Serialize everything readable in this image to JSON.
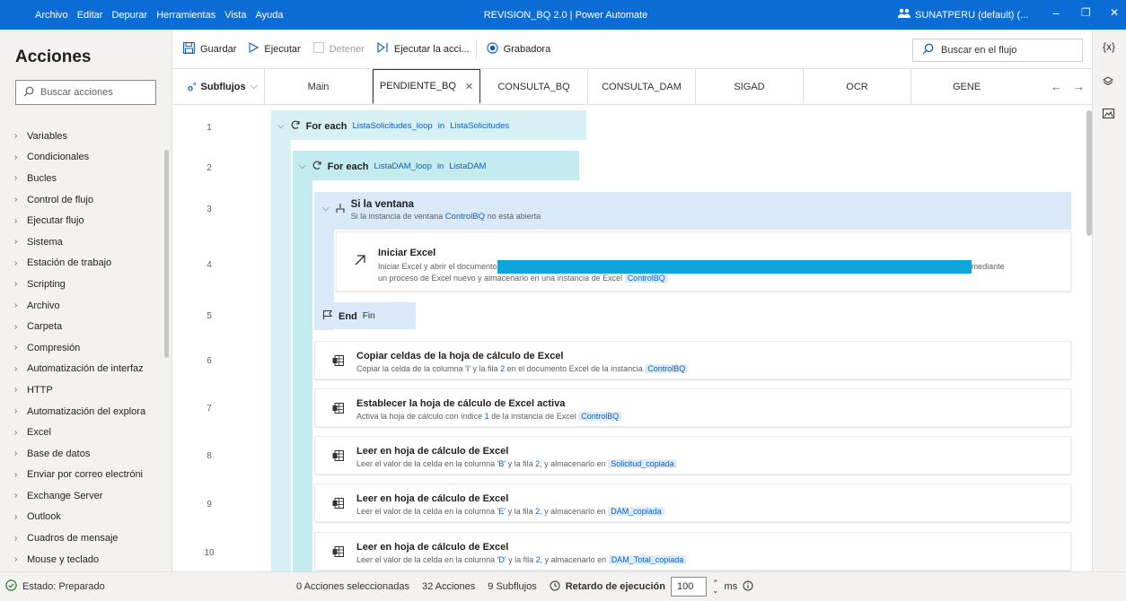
{
  "titlebar": {
    "menu": [
      "Archivo",
      "Editar",
      "Depurar",
      "Herramientas",
      "Vista",
      "Ayuda"
    ],
    "title": "REVISION_BQ 2.0 | Power Automate",
    "account": "SUNATPERU (default) (...",
    "minimize": "−",
    "maximize": "❐",
    "close": "✕"
  },
  "left": {
    "title": "Acciones",
    "search_placeholder": "Buscar acciones",
    "items": [
      "Variables",
      "Condicionales",
      "Bucles",
      "Control de flujo",
      "Ejecutar flujo",
      "Sistema",
      "Estación de trabajo",
      "Scripting",
      "Archivo",
      "Carpeta",
      "Compresión",
      "Automatización de interfaz",
      "HTTP",
      "Automatización del explora",
      "Excel",
      "Base de datos",
      "Enviar por correo electróni",
      "Exchange Server",
      "Outlook",
      "Cuadros de mensaje",
      "Mouse y teclado"
    ]
  },
  "toolbar": {
    "save": "Guardar",
    "run": "Ejecutar",
    "stop": "Detener",
    "run_action": "Ejecutar la acci...",
    "recorder": "Grabadora",
    "flow_search": "Buscar en el flujo"
  },
  "tabs": {
    "subflows": "Subflujos",
    "items": [
      "Main",
      "PENDIENTE_BQ",
      "CONSULTA_BQ",
      "CONSULTA_DAM",
      "SIGAD",
      "OCR",
      "GENE"
    ],
    "active_close": "✕"
  },
  "rightbar": {
    "vars_label": "{x}"
  },
  "flow": {
    "line_numbers": [
      "1",
      "2",
      "3",
      "4",
      "5",
      "6",
      "7",
      "8",
      "9",
      "10"
    ],
    "loop1": {
      "kw": "For each",
      "var": "ListaSolicitudes_loop",
      "in": "in",
      "list": "ListaSolicitudes"
    },
    "loop2": {
      "kw": "For each",
      "var": "ListaDAM_loop",
      "in": "in",
      "list": "ListaDAM"
    },
    "if": {
      "title": "Si la ventana",
      "desc_pre": "Si la instancia de ventana",
      "var": "ControlBQ",
      "desc_post": "no está abierta"
    },
    "excel_start": {
      "title": "Iniciar Excel",
      "desc1_pre": "Iniciar Excel y abrir el documento",
      "desc1_post": "mediante",
      "desc2_pre": "un proceso de Excel nuevo y almacenarlo en una instancia de Excel",
      "var": "ControlBQ"
    },
    "end": {
      "kw": "End",
      "label": "Fin"
    },
    "copy": {
      "title": "Copiar celdas de la hoja de cálculo de Excel",
      "desc_a": "Copiar la celda de la columna",
      "col": "'I'",
      "desc_b": "y la fila",
      "row": "2",
      "desc_c": "en el documento Excel de la instancia",
      "var": "ControlBQ"
    },
    "activate": {
      "title": "Establecer la hoja de cálculo de Excel activa",
      "desc_a": "Activa la hoja de cálculo con índice",
      "idx": "1",
      "desc_b": "de la instancia de Excel",
      "var": "ControlBQ"
    },
    "read1": {
      "title": "Leer en hoja de cálculo de Excel",
      "desc_a": "Leer el valor de la celda en la columna",
      "col": "'B'",
      "desc_b": "y la fila",
      "row": "2",
      "desc_c": ", y almacenarlo en",
      "var": "Solicitud_copiada"
    },
    "read2": {
      "title": "Leer en hoja de cálculo de Excel",
      "desc_a": "Leer el valor de la celda en la columna",
      "col": "'E'",
      "desc_b": "y la fila",
      "row": "2",
      "desc_c": ", y almacenarlo en",
      "var": "DAM_copiada"
    },
    "read3": {
      "title": "Leer en hoja de cálculo de Excel",
      "desc_a": "Leer el valor de la celda en la columna",
      "col": "'D'",
      "desc_b": "y la fila",
      "row": "2",
      "desc_c": ", y almacenarlo en",
      "var": "DAM_Total_copiada"
    }
  },
  "status": {
    "state": "Estado: Preparado",
    "selected": "0 Acciones seleccionadas",
    "actions": "32 Acciones",
    "subflows": "9 Subflujos",
    "delay_label": "Retardo de ejecución",
    "delay_value": "100",
    "unit": "ms"
  },
  "colors": {
    "titlebar": "#0c6cd6",
    "accent": "#0e5fbe",
    "loop_band": "#d6f0f3",
    "if_band": "#d9e9f9"
  }
}
